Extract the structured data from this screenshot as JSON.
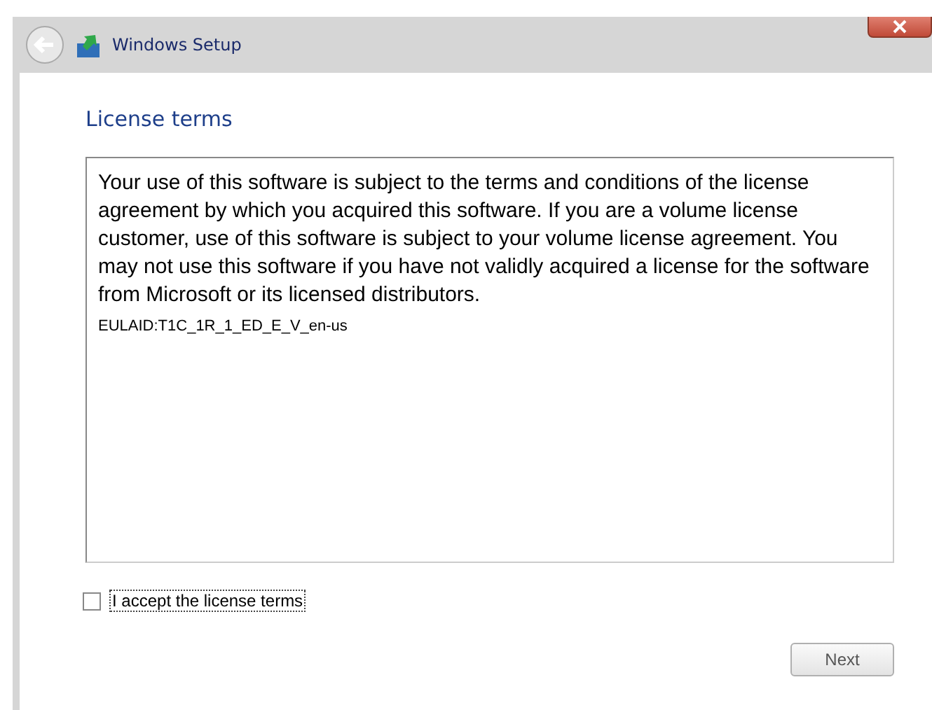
{
  "window": {
    "title": "Windows Setup"
  },
  "heading": "License terms",
  "license": {
    "paragraphs": [
      "Your use of this software is subject to the terms and conditions of the license agreement by which you acquired this software.  If you are a volume license customer, use of this software is subject to your volume license agreement.  You may not use this software if you have not validly acquired a license for the software from Microsoft or its licensed distributors."
    ],
    "eula_id": "EULAID:T1C_1R_1_ED_E_V_en-us"
  },
  "accept": {
    "label": "I accept the license terms",
    "checked": false
  },
  "next_button": {
    "label": "Next",
    "disabled": true
  }
}
